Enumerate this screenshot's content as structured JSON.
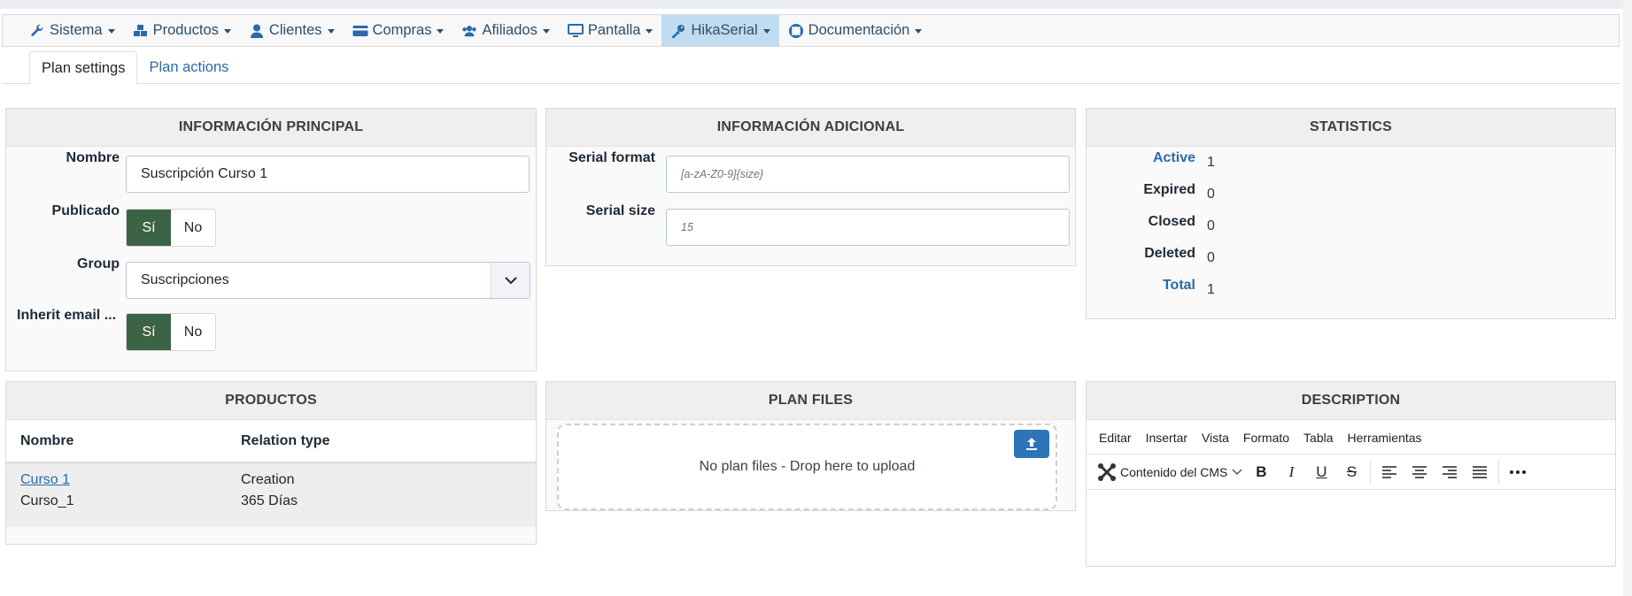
{
  "menu": {
    "items": [
      {
        "label": "Sistema",
        "icon": "wrench-icon"
      },
      {
        "label": "Productos",
        "icon": "cubes-icon"
      },
      {
        "label": "Clientes",
        "icon": "user-icon"
      },
      {
        "label": "Compras",
        "icon": "credit-card-icon"
      },
      {
        "label": "Afiliados",
        "icon": "users-icon"
      },
      {
        "label": "Pantalla",
        "icon": "desktop-icon"
      },
      {
        "label": "HikaSerial",
        "icon": "key-icon",
        "active": true
      },
      {
        "label": "Documentación",
        "icon": "lifebuoy-icon"
      }
    ]
  },
  "tabs": [
    {
      "label": "Plan settings",
      "active": true
    },
    {
      "label": "Plan actions",
      "active": false
    }
  ],
  "main_info": {
    "title": "INFORMACIÓN PRINCIPAL",
    "name_label": "Nombre",
    "name_value": "Suscripción Curso 1",
    "published_label": "Publicado",
    "published_yes": "Sí",
    "published_no": "No",
    "published_value": "Sí",
    "group_label": "Group",
    "group_value": "Suscripciones",
    "inherit_label": "Inherit email ...",
    "inherit_yes": "Sí",
    "inherit_no": "No",
    "inherit_value": "Sí"
  },
  "additional_info": {
    "title": "INFORMACIÓN ADICIONAL",
    "serial_format_label": "Serial format",
    "serial_format_placeholder": "[a-zA-Z0-9]{size}",
    "serial_size_label": "Serial size",
    "serial_size_placeholder": "15"
  },
  "statistics": {
    "title": "STATISTICS",
    "rows": [
      {
        "label": "Active",
        "value": "1",
        "link": true
      },
      {
        "label": "Expired",
        "value": "0",
        "link": false
      },
      {
        "label": "Closed",
        "value": "0",
        "link": false
      },
      {
        "label": "Deleted",
        "value": "0",
        "link": false
      },
      {
        "label": "Total",
        "value": "1",
        "link": true
      }
    ]
  },
  "products": {
    "title": "PRODUCTOS",
    "columns": [
      "Nombre",
      "Relation type"
    ],
    "rows": [
      {
        "name_link": "Curso 1",
        "code": "Curso_1",
        "relation": "Creation",
        "duration": "365 Días"
      }
    ]
  },
  "plan_files": {
    "title": "PLAN FILES",
    "empty_text": "No plan files - Drop here to upload"
  },
  "description": {
    "title": "DESCRIPTION",
    "menu": [
      "Editar",
      "Insertar",
      "Vista",
      "Formato",
      "Tabla",
      "Herramientas"
    ],
    "format_label": "Contenido del CMS"
  },
  "colors": {
    "toggle_on": "#3c6344",
    "link": "#2a6aaa",
    "menu_active": "#bfdcf0",
    "upload_button": "#2d74b8"
  }
}
